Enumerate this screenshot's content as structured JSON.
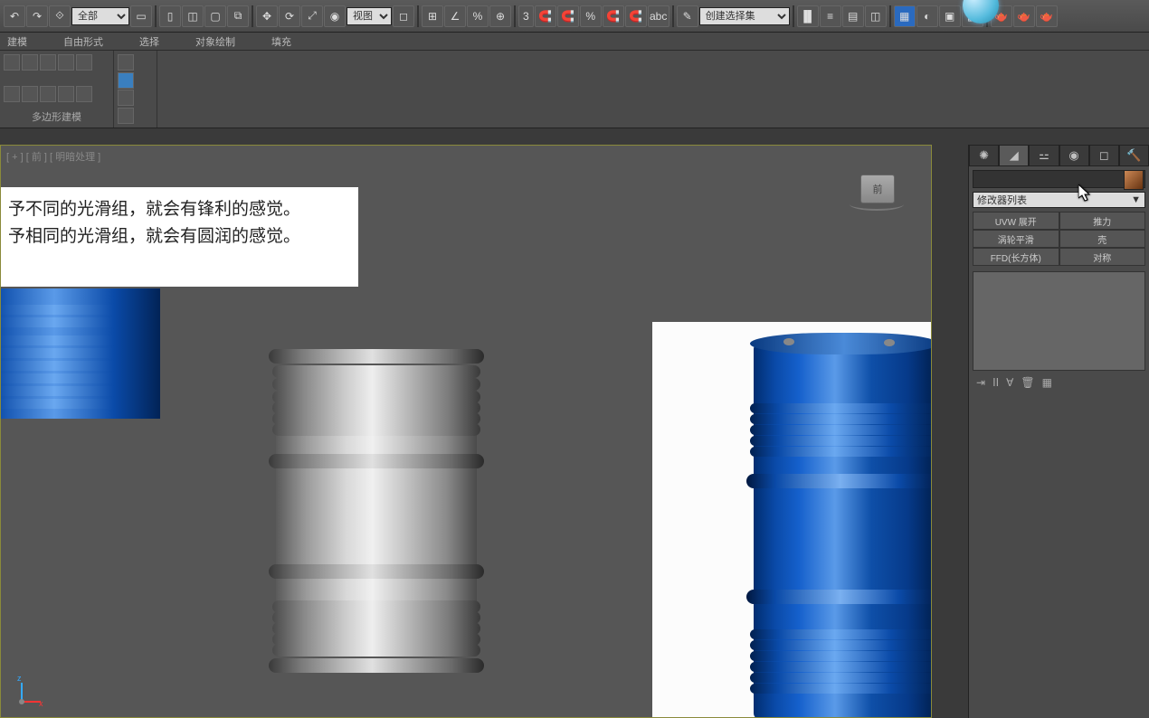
{
  "toolbar": {
    "filter_dropdown": "全部",
    "view_label": "视图",
    "number_label": "3",
    "create_set_dropdown": "创建选择集"
  },
  "menu": {
    "items": [
      "建模",
      "自由形式",
      "选择",
      "对象绘制",
      "填充"
    ]
  },
  "ribbon": {
    "group1_label": "多边形建模"
  },
  "viewport": {
    "label": "[ + ] [ 前 ] [ 明暗处理 ]",
    "viewcube": "前",
    "text_line_1": "予不同的光滑组，就会有锋利的感觉。",
    "text_line_2": "予相同的光滑组，就会有圆润的感觉。"
  },
  "right_panel": {
    "name_value": "",
    "modifier_dropdown": "修改器列表",
    "mod_buttons": [
      "UVW 展开",
      "推力",
      "涡轮平滑",
      "壳",
      "FFD(长方体)",
      "对称"
    ]
  }
}
